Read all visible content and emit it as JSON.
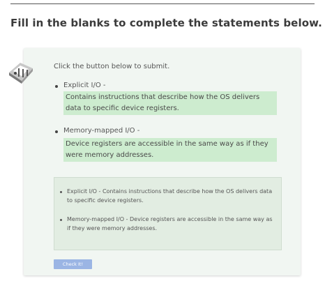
{
  "heading": "Fill in the blanks to complete the statements below.",
  "instruction": "Click the button below to submit.",
  "items": [
    {
      "term": "Explicit I/O -",
      "answer": "Contains instructions that describe how the OS delivers data to specific device registers."
    },
    {
      "term": "Memory-mapped I/O -",
      "answer": "Device registers are accessible in the same way as if they were memory addresses."
    }
  ],
  "summary": [
    "Explicit I/O - Contains instructions that describe how the OS delivers data to specific device registers.",
    "Memory-mapped I/O - Device registers are accessible in the same way as if they were memory addresses."
  ],
  "button_label": "Check It!",
  "colors": {
    "answer_bg": "#cdeccf",
    "card_bg": "#f1f6f2",
    "summary_bg": "#e2ede2",
    "button_bg": "#9bb5e4"
  },
  "icons": {
    "avatar": "robot-avatar-icon"
  }
}
